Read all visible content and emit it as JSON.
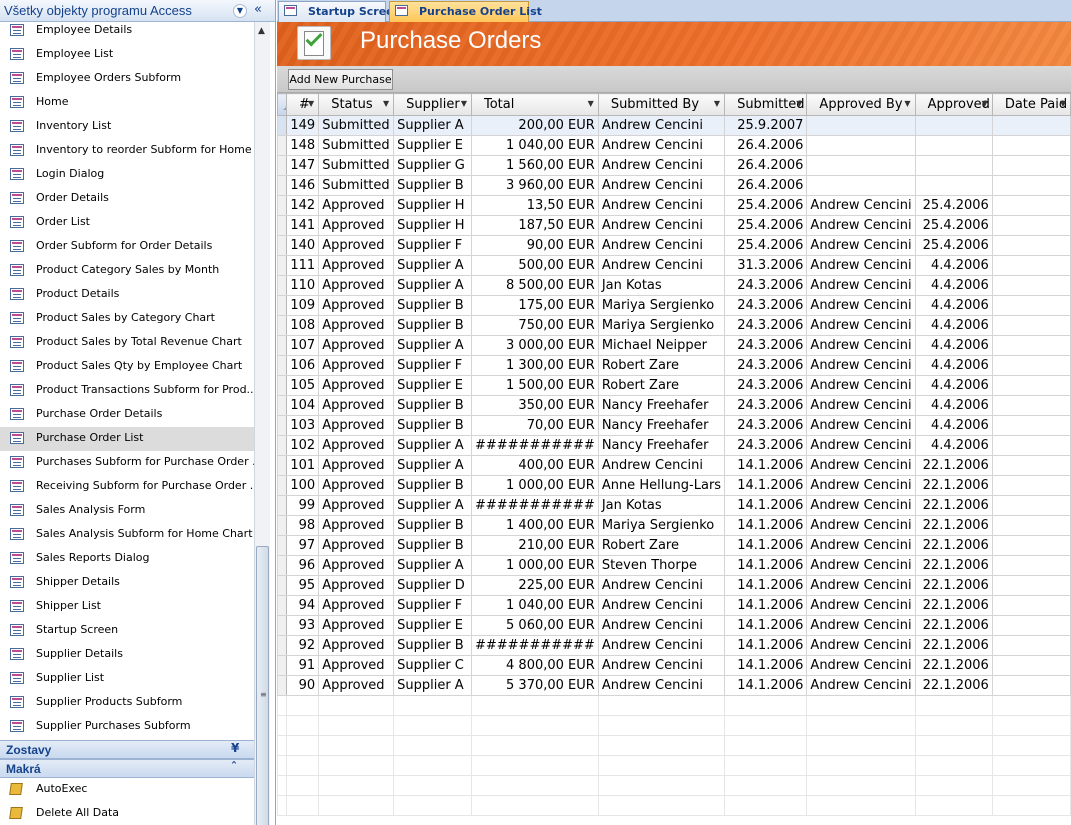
{
  "nav": {
    "title": "Všetky objekty programu Access",
    "forms": [
      "Employee Details",
      "Employee List",
      "Employee Orders Subform",
      "Home",
      "Inventory List",
      "Inventory to reorder Subform for Home",
      "Login Dialog",
      "Order Details",
      "Order List",
      "Order Subform for Order Details",
      "Product Category Sales by Month",
      "Product Details",
      "Product Sales by Category Chart",
      "Product Sales by Total Revenue Chart",
      "Product Sales Qty by Employee Chart",
      "Product Transactions Subform for Prod...",
      "Purchase Order Details",
      "Purchase Order List",
      "Purchases Subform for Purchase Order ...",
      "Receiving Subform for Purchase Order ...",
      "Sales Analysis Form",
      "Sales Analysis Subform for Home Chart",
      "Sales Reports Dialog",
      "Shipper Details",
      "Shipper List",
      "Startup Screen",
      "Supplier Details",
      "Supplier List",
      "Supplier Products Subform",
      "Supplier Purchases Subform"
    ],
    "selected": "Purchase Order List",
    "groups": [
      {
        "label": "Zostavy",
        "state": "collapsed"
      },
      {
        "label": "Makrá",
        "state": "expanded"
      }
    ],
    "macros": [
      "AutoExec",
      "Delete All Data"
    ]
  },
  "tabs": [
    {
      "label": "Startup Screen",
      "active": false
    },
    {
      "label": "Purchase Order List",
      "active": true
    }
  ],
  "form": {
    "title": "Purchase Orders",
    "add_button": "Add New Purchase"
  },
  "grid": {
    "columns": [
      "#",
      "Status",
      "Supplier",
      "Total",
      "Submitted By",
      "Submitted",
      "Approved By",
      "Approved",
      "Date Paid"
    ],
    "rows": [
      [
        "149",
        "Submitted",
        "Supplier A",
        "200,00 EUR",
        "Andrew Cencini",
        "25.9.2007",
        "",
        "",
        ""
      ],
      [
        "148",
        "Submitted",
        "Supplier E",
        "1 040,00 EUR",
        "Andrew Cencini",
        "26.4.2006",
        "",
        "",
        ""
      ],
      [
        "147",
        "Submitted",
        "Supplier G",
        "1 560,00 EUR",
        "Andrew Cencini",
        "26.4.2006",
        "",
        "",
        ""
      ],
      [
        "146",
        "Submitted",
        "Supplier B",
        "3 960,00 EUR",
        "Andrew Cencini",
        "26.4.2006",
        "",
        "",
        ""
      ],
      [
        "142",
        "Approved",
        "Supplier H",
        "13,50 EUR",
        "Andrew Cencini",
        "25.4.2006",
        "Andrew Cencini",
        "25.4.2006",
        ""
      ],
      [
        "141",
        "Approved",
        "Supplier H",
        "187,50 EUR",
        "Andrew Cencini",
        "25.4.2006",
        "Andrew Cencini",
        "25.4.2006",
        ""
      ],
      [
        "140",
        "Approved",
        "Supplier F",
        "90,00 EUR",
        "Andrew Cencini",
        "25.4.2006",
        "Andrew Cencini",
        "25.4.2006",
        ""
      ],
      [
        "111",
        "Approved",
        "Supplier A",
        "500,00 EUR",
        "Andrew Cencini",
        "31.3.2006",
        "Andrew Cencini",
        "4.4.2006",
        ""
      ],
      [
        "110",
        "Approved",
        "Supplier A",
        "8 500,00 EUR",
        "Jan Kotas",
        "24.3.2006",
        "Andrew Cencini",
        "4.4.2006",
        ""
      ],
      [
        "109",
        "Approved",
        "Supplier B",
        "175,00 EUR",
        "Mariya Sergienko",
        "24.3.2006",
        "Andrew Cencini",
        "4.4.2006",
        ""
      ],
      [
        "108",
        "Approved",
        "Supplier B",
        "750,00 EUR",
        "Mariya Sergienko",
        "24.3.2006",
        "Andrew Cencini",
        "4.4.2006",
        ""
      ],
      [
        "107",
        "Approved",
        "Supplier A",
        "3 000,00 EUR",
        "Michael Neipper",
        "24.3.2006",
        "Andrew Cencini",
        "4.4.2006",
        ""
      ],
      [
        "106",
        "Approved",
        "Supplier F",
        "1 300,00 EUR",
        "Robert Zare",
        "24.3.2006",
        "Andrew Cencini",
        "4.4.2006",
        ""
      ],
      [
        "105",
        "Approved",
        "Supplier E",
        "1 500,00 EUR",
        "Robert Zare",
        "24.3.2006",
        "Andrew Cencini",
        "4.4.2006",
        ""
      ],
      [
        "104",
        "Approved",
        "Supplier B",
        "350,00 EUR",
        "Nancy Freehafer",
        "24.3.2006",
        "Andrew Cencini",
        "4.4.2006",
        ""
      ],
      [
        "103",
        "Approved",
        "Supplier B",
        "70,00 EUR",
        "Nancy Freehafer",
        "24.3.2006",
        "Andrew Cencini",
        "4.4.2006",
        ""
      ],
      [
        "102",
        "Approved",
        "Supplier A",
        "###########",
        "Nancy Freehafer",
        "24.3.2006",
        "Andrew Cencini",
        "4.4.2006",
        ""
      ],
      [
        "101",
        "Approved",
        "Supplier A",
        "400,00 EUR",
        "Andrew Cencini",
        "14.1.2006",
        "Andrew Cencini",
        "22.1.2006",
        ""
      ],
      [
        "100",
        "Approved",
        "Supplier B",
        "1 000,00 EUR",
        "Anne Hellung-Lars",
        "14.1.2006",
        "Andrew Cencini",
        "22.1.2006",
        ""
      ],
      [
        "99",
        "Approved",
        "Supplier A",
        "###########",
        "Jan Kotas",
        "14.1.2006",
        "Andrew Cencini",
        "22.1.2006",
        ""
      ],
      [
        "98",
        "Approved",
        "Supplier B",
        "1 400,00 EUR",
        "Mariya Sergienko",
        "14.1.2006",
        "Andrew Cencini",
        "22.1.2006",
        ""
      ],
      [
        "97",
        "Approved",
        "Supplier B",
        "210,00 EUR",
        "Robert Zare",
        "14.1.2006",
        "Andrew Cencini",
        "22.1.2006",
        ""
      ],
      [
        "96",
        "Approved",
        "Supplier A",
        "1 000,00 EUR",
        "Steven Thorpe",
        "14.1.2006",
        "Andrew Cencini",
        "22.1.2006",
        ""
      ],
      [
        "95",
        "Approved",
        "Supplier D",
        "225,00 EUR",
        "Andrew Cencini",
        "14.1.2006",
        "Andrew Cencini",
        "22.1.2006",
        ""
      ],
      [
        "94",
        "Approved",
        "Supplier F",
        "1 040,00 EUR",
        "Andrew Cencini",
        "14.1.2006",
        "Andrew Cencini",
        "22.1.2006",
        ""
      ],
      [
        "93",
        "Approved",
        "Supplier E",
        "5 060,00 EUR",
        "Andrew Cencini",
        "14.1.2006",
        "Andrew Cencini",
        "22.1.2006",
        ""
      ],
      [
        "92",
        "Approved",
        "Supplier B",
        "###########",
        "Andrew Cencini",
        "14.1.2006",
        "Andrew Cencini",
        "22.1.2006",
        ""
      ],
      [
        "91",
        "Approved",
        "Supplier C",
        "4 800,00 EUR",
        "Andrew Cencini",
        "14.1.2006",
        "Andrew Cencini",
        "22.1.2006",
        ""
      ],
      [
        "90",
        "Approved",
        "Supplier A",
        "5 370,00 EUR",
        "Andrew Cencini",
        "14.1.2006",
        "Andrew Cencini",
        "22.1.2006",
        ""
      ]
    ],
    "current_row": 0
  },
  "colors": {
    "header_orange": "#e0611c",
    "nav_blue": "#15428b",
    "selected_tab": "#ffc659"
  }
}
